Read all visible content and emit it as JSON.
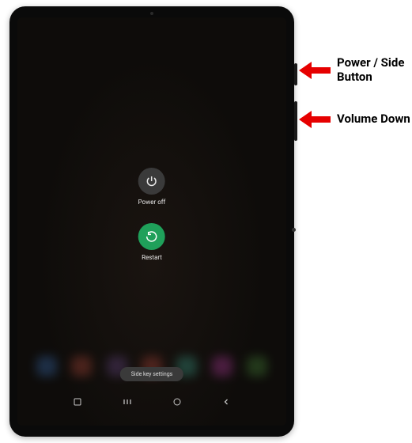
{
  "power_menu": {
    "power_off": {
      "label": "Power off"
    },
    "restart": {
      "label": "Restart"
    }
  },
  "side_key_settings": {
    "label": "Side key settings"
  },
  "annotations": {
    "power_side": "Power / Side Button",
    "volume_down": "Volume Down"
  }
}
